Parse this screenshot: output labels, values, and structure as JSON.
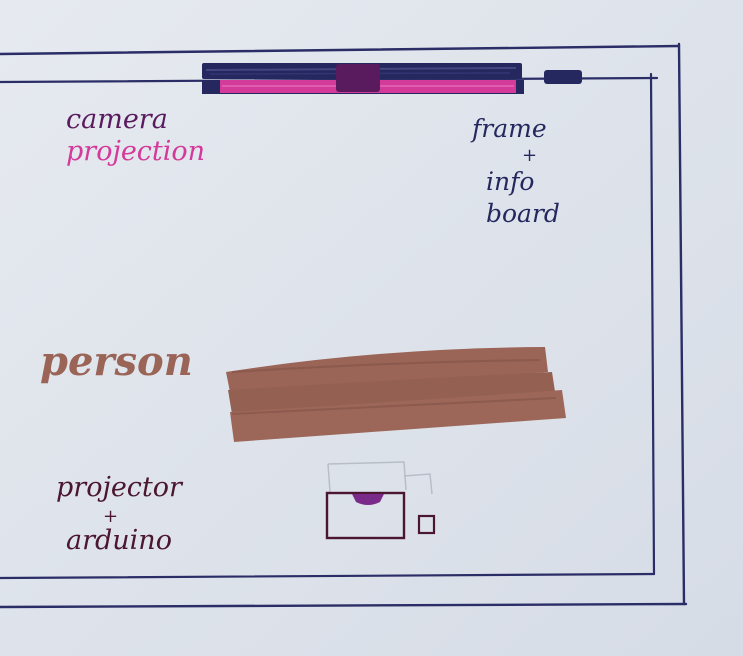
{
  "labels": {
    "camera_line1": "camera",
    "camera_line2": "projection",
    "frame_line1": "frame",
    "frame_plus": "+",
    "frame_line2": "info",
    "frame_line3": "board",
    "person": "person",
    "projector_line1": "projector",
    "projector_plus": "+",
    "projector_line2": "arduino"
  },
  "colors": {
    "paper": "#dfe4ec",
    "ink_navy": "#25285e",
    "magenta": "#d43a9a",
    "purple": "#5a1b5e",
    "brown": "#9a6456",
    "brown_dark": "#7c4e44",
    "maroon": "#4a1630"
  }
}
